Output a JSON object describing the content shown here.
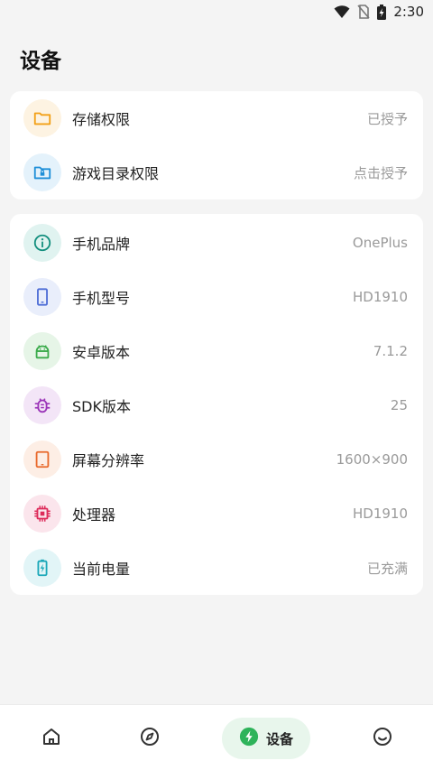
{
  "status": {
    "time": "2:30",
    "icons": [
      "wifi-icon",
      "no-sim-icon",
      "battery-charging-icon"
    ]
  },
  "title": "设备",
  "permissions": [
    {
      "icon": "folder-icon",
      "label": "存储权限",
      "value": "已授予",
      "color": "#f2a017",
      "bg": "#fdf3e2"
    },
    {
      "icon": "folder-lock-icon",
      "label": "游戏目录权限",
      "value": "点击授予",
      "color": "#1e8fd8",
      "bg": "#e4f2fb"
    }
  ],
  "device_info": [
    {
      "icon": "info-icon",
      "label": "手机品牌",
      "value": "OnePlus",
      "color": "#15907f",
      "bg": "#e0f3f0"
    },
    {
      "icon": "phone-icon",
      "label": "手机型号",
      "value": "HD1910",
      "color": "#4f6ed6",
      "bg": "#e9eefb"
    },
    {
      "icon": "android-icon",
      "label": "安卓版本",
      "value": "7.1.2",
      "color": "#3cab4c",
      "bg": "#e6f5e7"
    },
    {
      "icon": "bug-icon",
      "label": "SDK版本",
      "value": "25",
      "color": "#9b35b8",
      "bg": "#f3e5f7"
    },
    {
      "icon": "tablet-icon",
      "label": "屏幕分辨率",
      "value": "1600×900",
      "color": "#e8682a",
      "bg": "#fdeee5"
    },
    {
      "icon": "chip-icon",
      "label": "处理器",
      "value": "HD1910",
      "color": "#dd2b5a",
      "bg": "#fbe5ec"
    },
    {
      "icon": "battery-icon",
      "label": "当前电量",
      "value": "已充满",
      "color": "#1ba8b8",
      "bg": "#e2f5f7"
    }
  ],
  "nav": {
    "items": [
      {
        "icon": "home-icon"
      },
      {
        "icon": "compass-icon"
      },
      {
        "icon": "bolt-icon",
        "label": "设备",
        "active": true
      },
      {
        "icon": "smiley-icon"
      }
    ],
    "accent": "#2eb35a"
  }
}
